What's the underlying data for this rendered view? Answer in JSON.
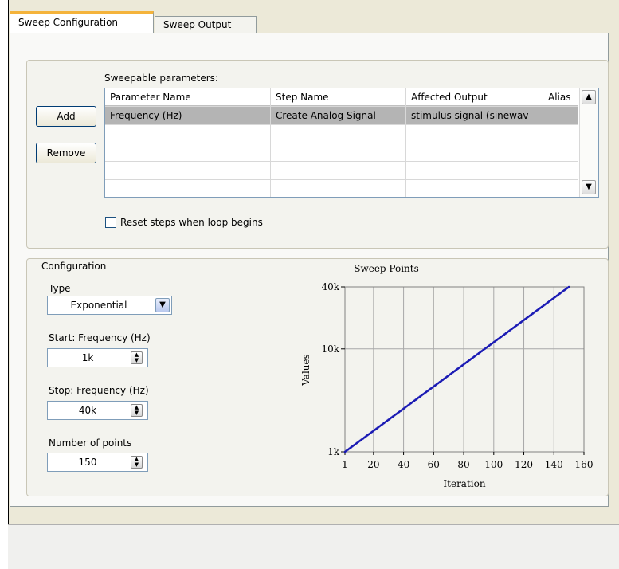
{
  "tabs": [
    {
      "label": "Sweep Configuration"
    },
    {
      "label": "Sweep Output"
    }
  ],
  "sweepable": {
    "label": "Sweepable parameters:",
    "add_label": "Add",
    "remove_label": "Remove",
    "columns": [
      "Parameter Name",
      "Step Name",
      "Affected Output",
      "Alias"
    ],
    "rows": [
      [
        "Frequency (Hz)",
        "Create Analog Signal",
        "stimulus signal (sinewav",
        ""
      ]
    ],
    "reset_label": "Reset steps when loop begins",
    "reset_checked": false
  },
  "configuration": {
    "legend": "Configuration",
    "type_label": "Type",
    "type_value": "Exponential",
    "start_label": "Start: Frequency (Hz)",
    "start_value": "1k",
    "stop_label": "Stop: Frequency (Hz)",
    "stop_value": "40k",
    "points_label": "Number of points",
    "points_value": "150"
  },
  "chart_data": {
    "type": "line",
    "title": "Sweep Points",
    "xlabel": "Iteration",
    "ylabel": "Values",
    "x_scale": "linear",
    "y_scale": "log",
    "xlim": [
      1,
      160
    ],
    "ylim": [
      1000,
      40000
    ],
    "x_ticks": [
      "1",
      "20",
      "40",
      "60",
      "80",
      "100",
      "120",
      "140",
      "160"
    ],
    "y_ticks": [
      "1k",
      "10k",
      "40k"
    ],
    "grid": true,
    "series": [
      {
        "x": [
          1,
          150
        ],
        "y": [
          1000,
          40000
        ],
        "points": 150,
        "color": "#3a3adc"
      }
    ]
  }
}
